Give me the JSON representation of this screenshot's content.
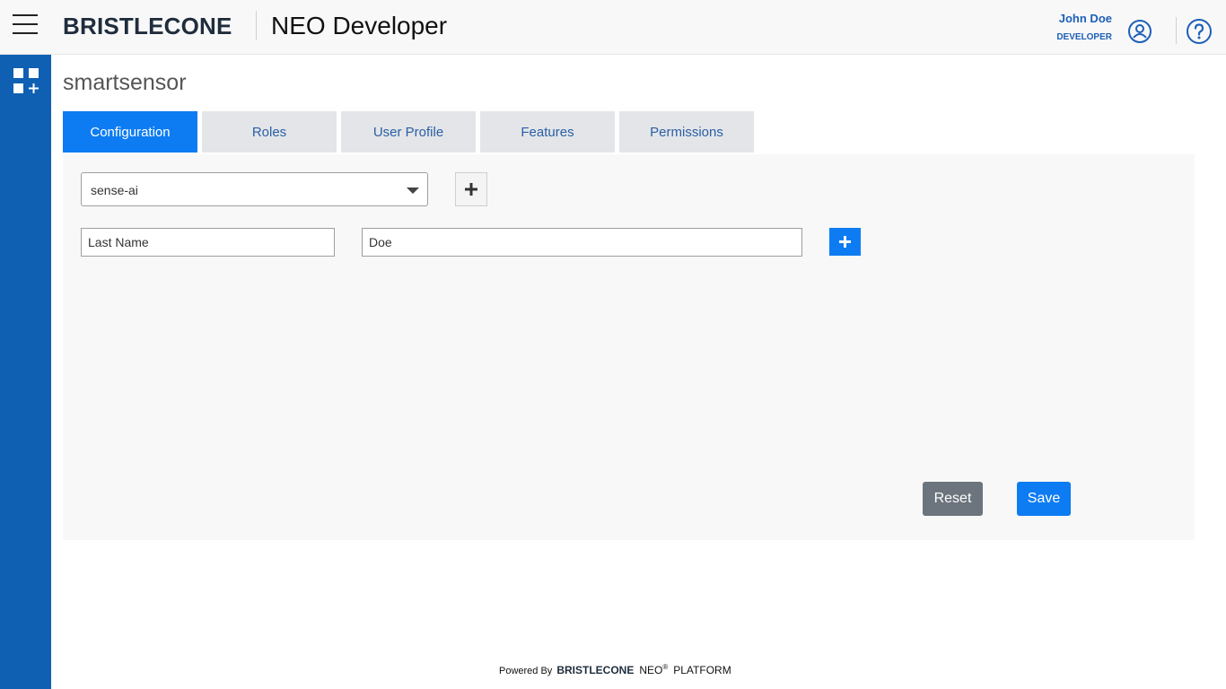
{
  "header": {
    "logo_text": "BRISTLECONE",
    "app_title": "NEO Developer",
    "user_name": "John Doe",
    "user_role": "DEVELOPER",
    "icons": [
      "menu-icon",
      "user-icon",
      "help-icon"
    ]
  },
  "sidebar": {
    "icons": [
      "apps-add-icon"
    ]
  },
  "page": {
    "title": "smartsensor"
  },
  "tabs": [
    {
      "label": "Configuration",
      "active": true
    },
    {
      "label": "Roles",
      "active": false
    },
    {
      "label": "User Profile",
      "active": false
    },
    {
      "label": "Features",
      "active": false
    },
    {
      "label": "Permissions",
      "active": false
    }
  ],
  "config": {
    "selected_app": "sense-ai",
    "row": {
      "key_value": "Last Name",
      "value_value": "Doe"
    }
  },
  "actions": {
    "reset_label": "Reset",
    "save_label": "Save"
  },
  "footer": {
    "powered_by": "Powered By",
    "logo_text": "BRISTLECONE",
    "neo": "NEO",
    "reg": "®",
    "platform": "PLATFORM"
  },
  "colors": {
    "primary": "#0d7cf2",
    "sidebar": "#0f5fb3",
    "reset": "#6c757d"
  }
}
